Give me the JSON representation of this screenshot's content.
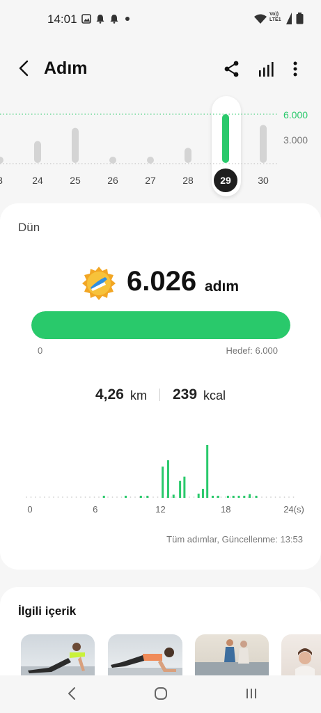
{
  "status_bar": {
    "time": "14:01",
    "icons": [
      "image-icon",
      "bell-icon",
      "bell-icon",
      "dot-icon"
    ],
    "right_icons": [
      "wifi-icon",
      "volte-icon",
      "battery-icon"
    ],
    "network_label": "Vo)) LTE1"
  },
  "header": {
    "title": "Adım",
    "actions": [
      "back-icon",
      "share-icon",
      "stats-icon",
      "more-vertical-icon"
    ]
  },
  "week_chart": {
    "days": [
      "3",
      "24",
      "25",
      "26",
      "27",
      "28",
      "29",
      "30"
    ],
    "levels": [
      0,
      0.45,
      0.72,
      0,
      0,
      0.31,
      1.0,
      0.78
    ],
    "selected_index": 6,
    "goal_label": "6.000",
    "mid_label": "3.000",
    "accent": "#29c96b"
  },
  "summary": {
    "day_label": "Dün",
    "steps": "6.026",
    "steps_unit": "adım",
    "progress_fraction": 1.0,
    "progress_min_label": "0",
    "progress_goal_label": "Hedef: 6.000",
    "distance_value": "4,26",
    "distance_unit": "km",
    "kcal_value": "239",
    "kcal_unit": "kcal",
    "update_text": "Tüm adımlar, Güncellenme: 13:53"
  },
  "chart_data": {
    "type": "bar",
    "x_ticks": [
      "0",
      "6",
      "12",
      "18",
      "24(s)"
    ],
    "values": [
      0,
      0,
      0,
      0,
      0,
      0,
      0,
      0,
      0,
      0,
      0,
      0,
      0.0,
      0,
      0,
      0,
      0,
      0,
      0,
      0,
      0,
      0,
      0,
      0,
      0,
      0,
      0,
      0,
      0,
      0,
      0,
      0,
      0,
      0,
      0,
      0,
      0,
      0,
      0,
      0,
      0,
      0,
      0,
      0,
      0,
      0,
      0,
      0
    ],
    "bars": [
      {
        "hour": 6.8,
        "level": 0.04
      },
      {
        "hour": 8.8,
        "level": 0.04
      },
      {
        "hour": 10.2,
        "level": 0.04
      },
      {
        "hour": 10.8,
        "level": 0.04
      },
      {
        "hour": 12.2,
        "level": 0.59
      },
      {
        "hour": 12.7,
        "level": 0.71
      },
      {
        "hour": 13.2,
        "level": 0.06
      },
      {
        "hour": 13.8,
        "level": 0.32
      },
      {
        "hour": 14.2,
        "level": 0.4
      },
      {
        "hour": 15.5,
        "level": 0.08
      },
      {
        "hour": 15.9,
        "level": 0.17
      },
      {
        "hour": 16.3,
        "level": 1.0
      },
      {
        "hour": 16.8,
        "level": 0.04
      },
      {
        "hour": 17.3,
        "level": 0.04
      },
      {
        "hour": 18.2,
        "level": 0.04
      },
      {
        "hour": 18.7,
        "level": 0.04
      },
      {
        "hour": 19.2,
        "level": 0.04
      },
      {
        "hour": 19.7,
        "level": 0.04
      },
      {
        "hour": 20.2,
        "level": 0.07
      },
      {
        "hour": 20.8,
        "level": 0.04
      }
    ],
    "color": "#29c96b"
  },
  "related": {
    "title": "İlgili içerik",
    "items": [
      "fitness-thumbnail-1",
      "fitness-thumbnail-2",
      "fitness-thumbnail-3",
      "fitness-thumbnail-4"
    ]
  },
  "nav_bar": {
    "icons": [
      "back-nav-icon",
      "home-nav-icon",
      "recents-nav-icon"
    ]
  }
}
